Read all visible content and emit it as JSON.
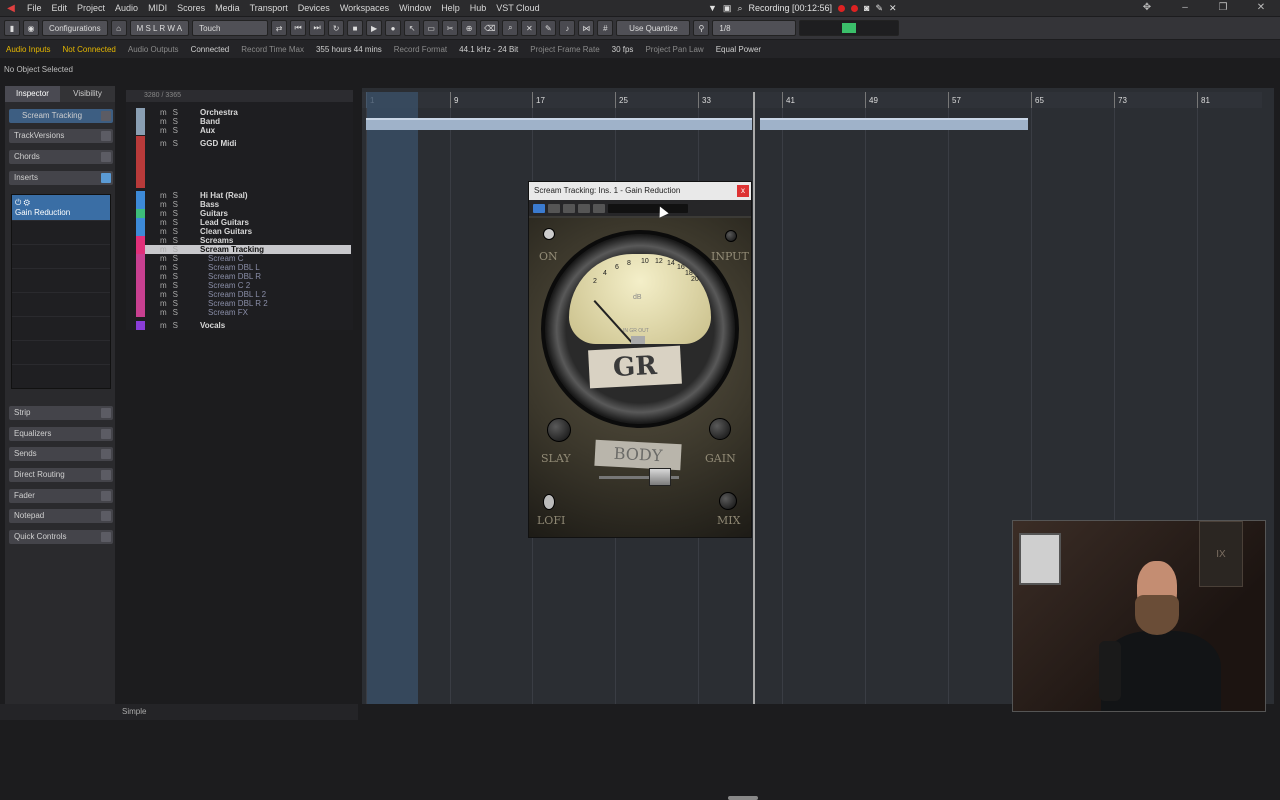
{
  "menubar": {
    "items": [
      "File",
      "Edit",
      "Project",
      "Audio",
      "MIDI",
      "Scores",
      "Media",
      "Transport",
      "Devices",
      "Workspaces",
      "Window",
      "Help",
      "Hub",
      "VST Cloud"
    ],
    "recording": "Recording [00:12:56]"
  },
  "toolbar": {
    "configurations": "Configurations",
    "touch": "Touch",
    "ms_letters": "M S L R W A",
    "use_quantize": "Use Quantize",
    "quantize_value": "1/8"
  },
  "status": {
    "audio_inputs": "Audio Inputs",
    "not_connected": "Not Connected",
    "audio_outputs": "Audio Outputs",
    "connected": "Connected",
    "record_time_max_label": "Record Time Max",
    "record_time_max": "355 hours 44 mins",
    "record_format_label": "Record Format",
    "record_format": "44.1 kHz - 24 Bit",
    "frame_rate_label": "Project Frame Rate",
    "frame_rate": "30 fps",
    "pan_law_label": "Project Pan Law",
    "pan_law": "Equal Power"
  },
  "info_line": "No Object Selected",
  "inspector": {
    "tab_inspector": "Inspector",
    "tab_visibility": "Visibility",
    "track_name": "Scream Tracking",
    "sections": [
      "TrackVersions",
      "Chords",
      "Inserts"
    ],
    "insert_slot": "Gain Reduction",
    "bottom_sections": [
      "Strip",
      "Equalizers",
      "Sends",
      "Direct Routing",
      "Fader",
      "Notepad",
      "Quick Controls"
    ]
  },
  "tracklist": {
    "header": "3280 / 3365",
    "tracks": [
      {
        "name": "Orchestra",
        "child": false
      },
      {
        "name": "Band",
        "child": false
      },
      {
        "name": "Aux",
        "child": false
      },
      {
        "name": "GGD Midi",
        "child": false
      },
      {
        "name": "Hi Hat (Real)",
        "child": false
      },
      {
        "name": "Bass",
        "child": false
      },
      {
        "name": "Guitars",
        "child": false
      },
      {
        "name": "Lead Guitars",
        "child": false
      },
      {
        "name": "Clean Guitars",
        "child": false
      },
      {
        "name": "Screams",
        "child": false
      },
      {
        "name": "Scream Tracking",
        "child": false
      },
      {
        "name": "Scream C",
        "child": true
      },
      {
        "name": "Scream DBL L",
        "child": true
      },
      {
        "name": "Scream DBL R",
        "child": true
      },
      {
        "name": "Scream C 2",
        "child": true
      },
      {
        "name": "Scream DBL L 2",
        "child": true
      },
      {
        "name": "Scream DBL R 2",
        "child": true
      },
      {
        "name": "Scream FX",
        "child": true
      },
      {
        "name": "Vocals",
        "child": false
      }
    ]
  },
  "bottom": {
    "mode": "Simple"
  },
  "ruler": {
    "marks": [
      "1",
      "9",
      "17",
      "25",
      "33",
      "41",
      "49",
      "57",
      "65",
      "73",
      "81"
    ]
  },
  "plugin": {
    "title": "Scream Tracking: Ins. 1 - Gain Reduction",
    "close": "x",
    "labels": {
      "on": "ON",
      "input": "INPUT",
      "slay": "SLAY",
      "gain": "GAIN",
      "lofi": "LOFI",
      "mix": "MIX",
      "gr": "GR",
      "body": "BODY",
      "db": "dB",
      "in_gr_out": "IN GR OUT"
    },
    "vu_numbers": [
      "2",
      "4",
      "6",
      "8",
      "10",
      "12",
      "14",
      "16",
      "18",
      "20"
    ]
  },
  "colors": {
    "accent_blue": "#3a6ea5",
    "warn": "#e6b800",
    "record": "#dd2222"
  }
}
